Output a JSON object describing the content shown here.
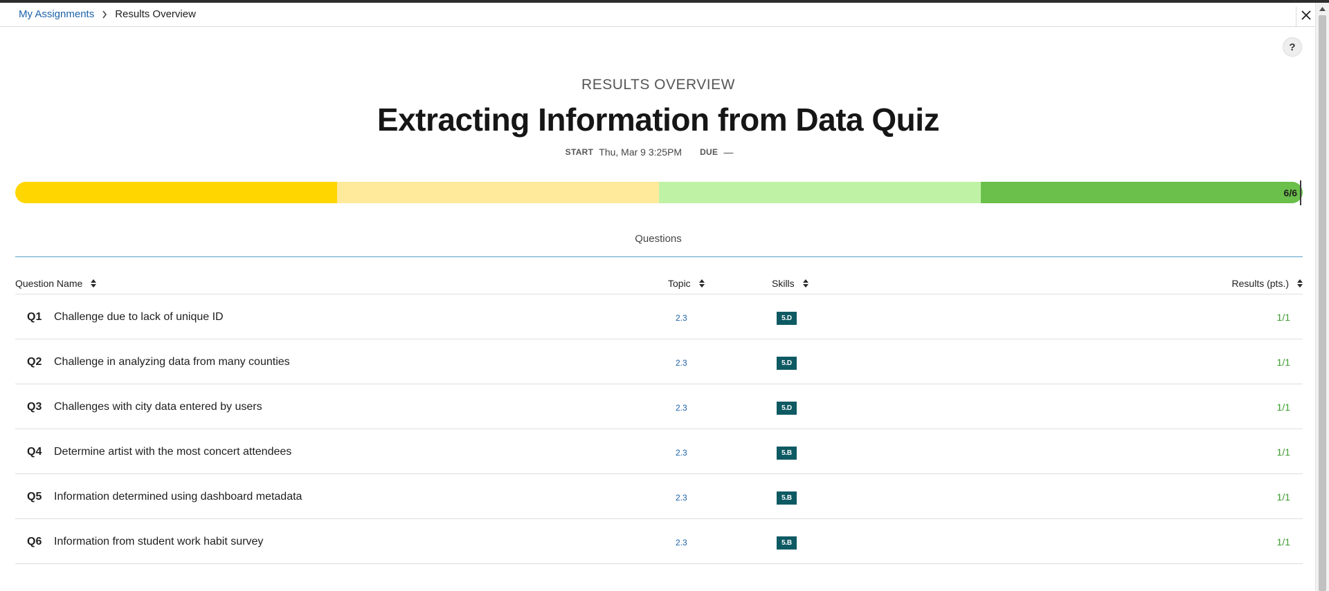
{
  "breadcrumb": {
    "link_label": "My Assignments",
    "current_label": "Results Overview"
  },
  "header": {
    "overline": "RESULTS OVERVIEW",
    "title": "Extracting Information from Data Quiz",
    "start_label": "START",
    "start_value": "Thu, Mar 9 3:25PM",
    "due_label": "DUE",
    "due_value": "—"
  },
  "help": {
    "label": "?"
  },
  "progress": {
    "label": "6/6",
    "score": 6,
    "total": 6,
    "segment_colors": [
      "#ffd600",
      "#ffea9c",
      "#c0f2a6",
      "#6ac04a"
    ]
  },
  "tabs": {
    "questions_label": "Questions"
  },
  "table": {
    "columns": {
      "name": "Question Name",
      "topic": "Topic",
      "skills": "Skills",
      "results": "Results (pts.)"
    },
    "rows": [
      {
        "num": "Q1",
        "name": "Challenge due to lack of unique ID",
        "topic": "2.3",
        "skill": "5.D",
        "result": "1/1"
      },
      {
        "num": "Q2",
        "name": "Challenge in analyzing data from many counties",
        "topic": "2.3",
        "skill": "5.D",
        "result": "1/1"
      },
      {
        "num": "Q3",
        "name": "Challenges with city data entered by users",
        "topic": "2.3",
        "skill": "5.D",
        "result": "1/1"
      },
      {
        "num": "Q4",
        "name": "Determine artist with the most concert attendees",
        "topic": "2.3",
        "skill": "5.B",
        "result": "1/1"
      },
      {
        "num": "Q5",
        "name": "Information determined using dashboard metadata",
        "topic": "2.3",
        "skill": "5.B",
        "result": "1/1"
      },
      {
        "num": "Q6",
        "name": "Information from student work habit survey",
        "topic": "2.3",
        "skill": "5.B",
        "result": "1/1"
      }
    ]
  },
  "colors": {
    "link": "#1a61a8",
    "skill_badge": "#0e5a63",
    "result_text": "#3b9c2d",
    "tab_underline": "#5aa0c8"
  },
  "icons": {
    "close": "close-icon",
    "breadcrumb_separator": "chevron-right-icon",
    "sort": "sort-icon",
    "scroll_up": "arrow-up-icon"
  }
}
